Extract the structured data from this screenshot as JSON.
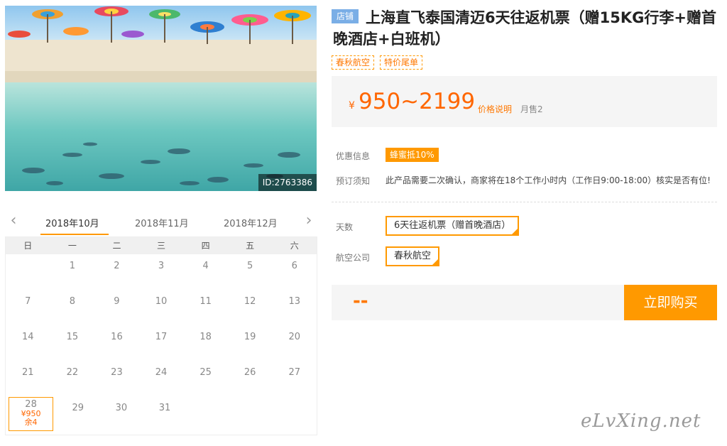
{
  "hero": {
    "id_label": "ID:2763386"
  },
  "calendar": {
    "prev_icon": "chevron-left-icon",
    "next_icon": "chevron-right-icon",
    "months": [
      "2018年10月",
      "2018年11月",
      "2018年12月"
    ],
    "weekdays": [
      "日",
      "一",
      "二",
      "三",
      "四",
      "五",
      "六"
    ],
    "rows": [
      [
        "",
        "1",
        "2",
        "3",
        "4",
        "5",
        "6"
      ],
      [
        "7",
        "8",
        "9",
        "10",
        "11",
        "12",
        "13"
      ],
      [
        "14",
        "15",
        "16",
        "17",
        "18",
        "19",
        "20"
      ],
      [
        "21",
        "22",
        "23",
        "24",
        "25",
        "26",
        "27"
      ],
      [
        "28",
        "29",
        "30",
        "31",
        "",
        "",
        ""
      ]
    ],
    "active_day": {
      "day": "28",
      "price": "¥950",
      "stock": "余4"
    }
  },
  "product": {
    "shop_badge": "店铺",
    "title": "上海直飞泰国清迈6天往返机票（赠15KG行李+赠首晚酒店+白班机）",
    "tags": [
      "春秋航空",
      "特价尾单"
    ],
    "price_yen": "¥",
    "price_range": "950~2199",
    "price_note": "价格说明",
    "sold_label": "月售2",
    "promo_label": "优惠信息",
    "promo_badge": "蜂蜜抵10%",
    "notice_label": "预订须知",
    "notice_text": "此产品需要二次确认，商家将在18个工作小时内（工作日9:00-18:00）核实是否有位!",
    "days_label": "天数",
    "days_option": "6天往返机票（赠首晚酒店）",
    "airline_label": "航空公司",
    "airline_option": "春秋航空",
    "total": "--",
    "buy_button": "立即购买"
  },
  "watermark": "eLvXing.net",
  "colors": {
    "accent": "#ff9900",
    "price": "#ff6600",
    "badge_blue": "#7aaee6"
  }
}
